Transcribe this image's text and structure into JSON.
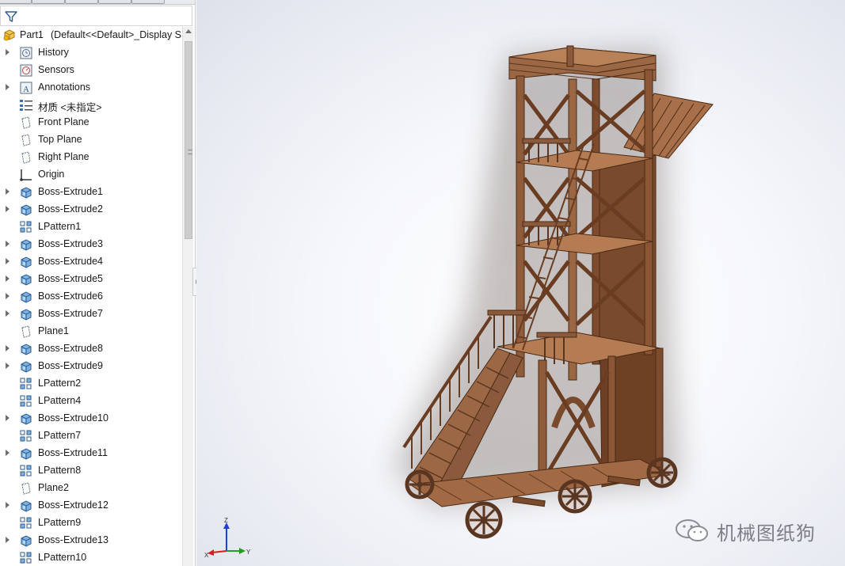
{
  "feature_tree": {
    "root": {
      "label": "Part1",
      "config": "(Default<<Default>_Display S"
    },
    "items": [
      {
        "label": "History",
        "icon": "history-icon",
        "expandable": true
      },
      {
        "label": "Sensors",
        "icon": "sensors-icon",
        "expandable": false
      },
      {
        "label": "Annotations",
        "icon": "annotations-icon",
        "expandable": true
      },
      {
        "label": "材质 <未指定>",
        "icon": "material-icon",
        "expandable": false
      },
      {
        "label": "Front Plane",
        "icon": "plane-icon",
        "expandable": false
      },
      {
        "label": "Top Plane",
        "icon": "plane-icon",
        "expandable": false
      },
      {
        "label": "Right Plane",
        "icon": "plane-icon",
        "expandable": false
      },
      {
        "label": "Origin",
        "icon": "origin-icon",
        "expandable": false
      },
      {
        "label": "Boss-Extrude1",
        "icon": "extrude-icon",
        "expandable": true
      },
      {
        "label": "Boss-Extrude2",
        "icon": "extrude-icon",
        "expandable": true
      },
      {
        "label": "LPattern1",
        "icon": "linear-pattern-icon",
        "expandable": false
      },
      {
        "label": "Boss-Extrude3",
        "icon": "extrude-icon",
        "expandable": true
      },
      {
        "label": "Boss-Extrude4",
        "icon": "extrude-icon",
        "expandable": true
      },
      {
        "label": "Boss-Extrude5",
        "icon": "extrude-icon",
        "expandable": true
      },
      {
        "label": "Boss-Extrude6",
        "icon": "extrude-icon",
        "expandable": true
      },
      {
        "label": "Boss-Extrude7",
        "icon": "extrude-icon",
        "expandable": true
      },
      {
        "label": "Plane1",
        "icon": "plane-icon",
        "expandable": false
      },
      {
        "label": "Boss-Extrude8",
        "icon": "extrude-icon",
        "expandable": true
      },
      {
        "label": "Boss-Extrude9",
        "icon": "extrude-icon",
        "expandable": true
      },
      {
        "label": "LPattern2",
        "icon": "linear-pattern-icon",
        "expandable": false
      },
      {
        "label": "LPattern4",
        "icon": "linear-pattern-icon",
        "expandable": false
      },
      {
        "label": "Boss-Extrude10",
        "icon": "extrude-icon",
        "expandable": true
      },
      {
        "label": "LPattern7",
        "icon": "linear-pattern-icon",
        "expandable": false
      },
      {
        "label": "Boss-Extrude11",
        "icon": "extrude-icon",
        "expandable": true
      },
      {
        "label": "LPattern8",
        "icon": "linear-pattern-icon",
        "expandable": false
      },
      {
        "label": "Plane2",
        "icon": "plane-icon",
        "expandable": false
      },
      {
        "label": "Boss-Extrude12",
        "icon": "extrude-icon",
        "expandable": true
      },
      {
        "label": "LPattern9",
        "icon": "linear-pattern-icon",
        "expandable": false
      },
      {
        "label": "Boss-Extrude13",
        "icon": "extrude-icon",
        "expandable": true
      },
      {
        "label": "LPattern10",
        "icon": "linear-pattern-icon",
        "expandable": false
      }
    ]
  },
  "triad": {
    "x": "X",
    "y": "Y",
    "z": "Z",
    "x_color": "#d02020",
    "y_color": "#20a020",
    "z_color": "#2040d0"
  },
  "watermark": {
    "text": "机械图纸狗"
  },
  "colors": {
    "wood": "#8b5a3c",
    "wood_light": "#b07a55",
    "wood_dark": "#5a3520",
    "accent": "#1f6fc9"
  }
}
